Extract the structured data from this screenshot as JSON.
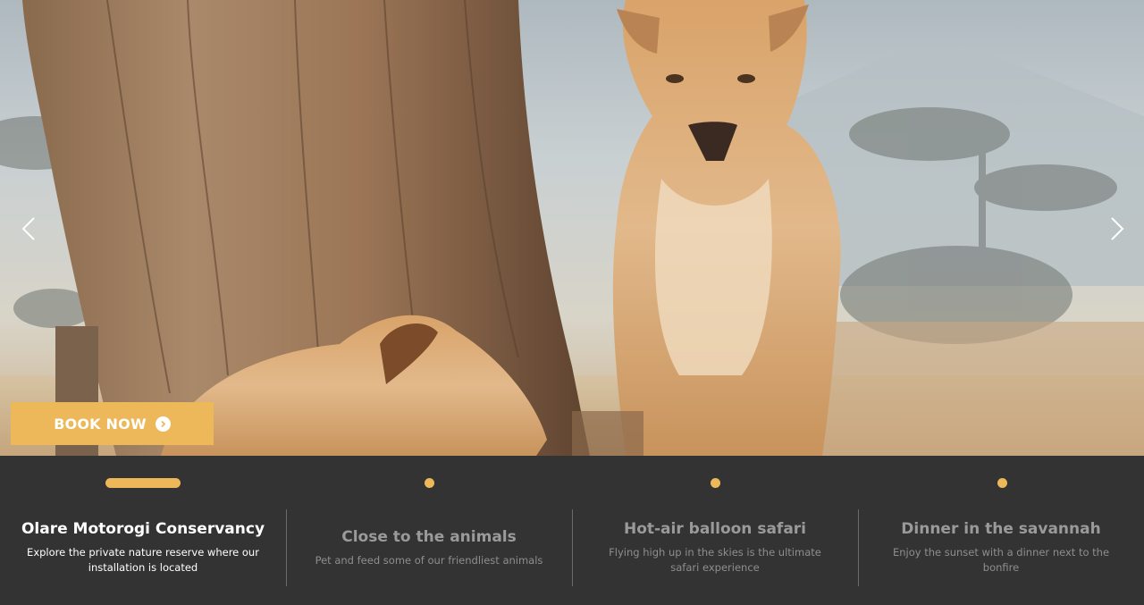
{
  "hero": {
    "prev_icon": "chevron-left-icon",
    "next_icon": "chevron-right-icon"
  },
  "book_button": {
    "label": "BOOK NOW",
    "icon": "arrow-circle-right-icon",
    "color": "#ecb85a"
  },
  "features": [
    {
      "title": "Olare Motorogi Conservancy",
      "description": "Explore the private nature reserve where our installation is located",
      "active": true
    },
    {
      "title": "Close to the animals",
      "description": "Pet and feed some of our friendliest animals",
      "active": false
    },
    {
      "title": "Hot-air balloon safari",
      "description": "Flying high up in the skies is the ultimate safari experience",
      "active": false
    },
    {
      "title": "Dinner in the savannah",
      "description": "Enjoy the sunset with a dinner next to the bonfire",
      "active": false
    }
  ],
  "colors": {
    "accent": "#ecb85a",
    "panel_bg": "#333333"
  }
}
